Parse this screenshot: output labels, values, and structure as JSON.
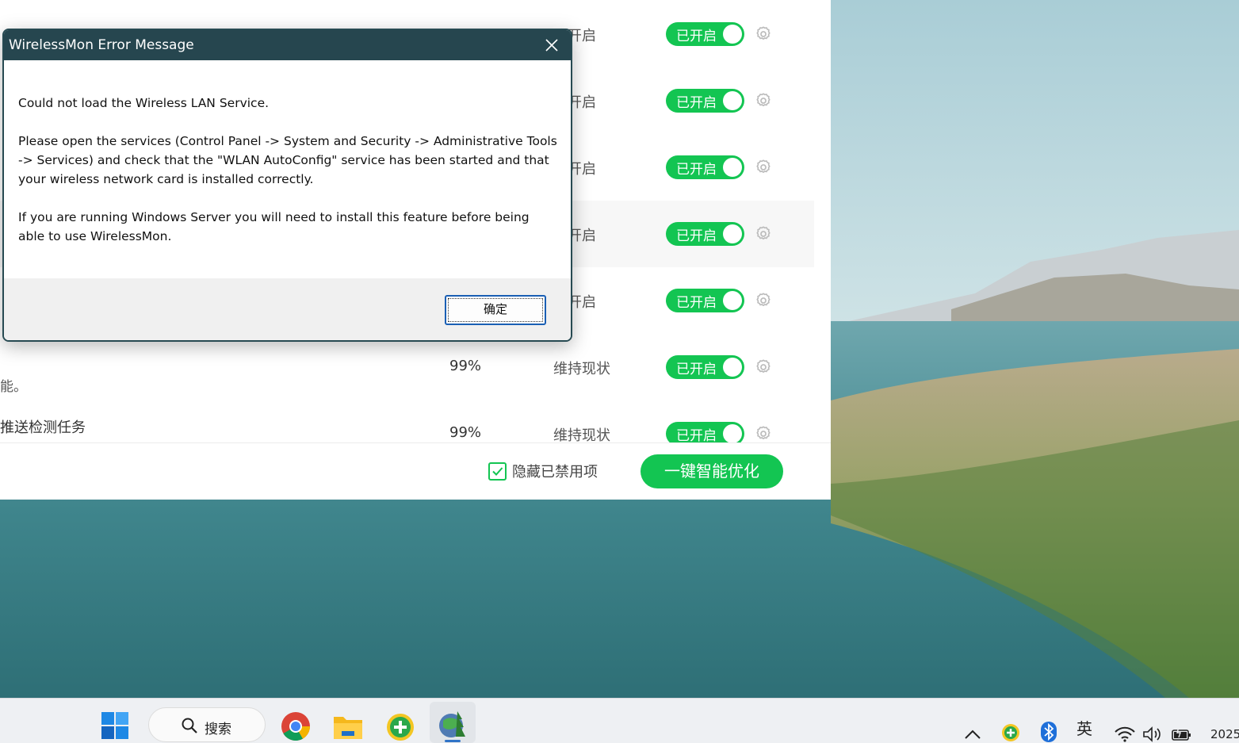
{
  "dialog": {
    "title": "WirelessMon Error Message",
    "line1": "Could not load the Wireless LAN Service.",
    "line2": "Please open the services (Control Panel -> System and Security -> Administrative Tools -> Services) and check that the \"WLAN AutoConfig\" service has been started and that your wireless network card is installed correctly.",
    "line3": "If you are running Windows Server you will need to install this feature before being able to use WirelessMon.",
    "ok_label": "确定"
  },
  "app": {
    "rows": [
      {
        "pct": "",
        "status": "议开启",
        "toggle": "已开启"
      },
      {
        "pct": "",
        "status": "议开启",
        "toggle": "已开启"
      },
      {
        "pct": "",
        "status": "议开启",
        "toggle": "已开启"
      },
      {
        "pct": "",
        "status": "议开启",
        "toggle": "已开启"
      },
      {
        "pct": "",
        "status": "议开启",
        "toggle": "已开启"
      },
      {
        "pct": "99%",
        "status": "维持现状",
        "toggle": "已开启",
        "sub": "能。"
      },
      {
        "pct": "99%",
        "status": "维持现状",
        "toggle": "已开启",
        "desc": "推送检测任务"
      }
    ],
    "footer": {
      "hide_disabled_label": "隐藏已禁用项",
      "hide_disabled_checked": true,
      "optimize_label": "一键智能优化"
    },
    "accent_color": "#13c552"
  },
  "taskbar": {
    "search_label": "搜索",
    "ime_label": "英",
    "clock_year": "2025",
    "icons": [
      "windows-start-icon",
      "search-icon",
      "chrome-icon",
      "file-explorer-icon",
      "green-plus-app-icon",
      "wirelessmon-icon",
      "chevron-up-icon",
      "tray-app-icon",
      "bluetooth-icon",
      "wifi-icon",
      "volume-icon",
      "battery-icon"
    ]
  }
}
